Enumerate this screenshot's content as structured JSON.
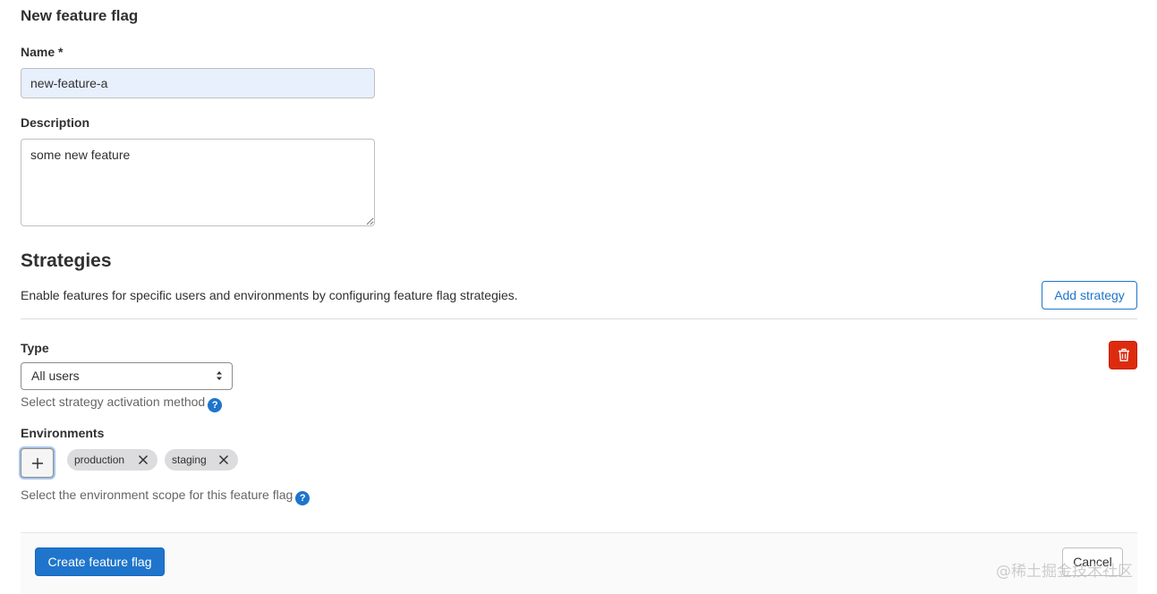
{
  "page": {
    "title": "New feature flag"
  },
  "form": {
    "name_label": "Name *",
    "name_value": "new-feature-a",
    "description_label": "Description",
    "description_value": "some new feature"
  },
  "strategies": {
    "heading": "Strategies",
    "description": "Enable features for specific users and environments by configuring feature flag strategies.",
    "add_label": "Add strategy",
    "type_label": "Type",
    "type_value": "All users",
    "type_help": "Select strategy activation method",
    "environments_label": "Environments",
    "environments": [
      {
        "name": "production"
      },
      {
        "name": "staging"
      }
    ],
    "environments_help": "Select the environment scope for this feature flag"
  },
  "footer": {
    "create_label": "Create feature flag",
    "cancel_label": "Cancel"
  },
  "watermark": "@稀土掘金技术社区",
  "icons": {
    "help": "question-circle-icon",
    "delete": "trash-icon",
    "add_env": "plus-icon",
    "remove_chip": "close-icon",
    "select": "select-arrows-icon"
  },
  "colors": {
    "primary": "#1f75cb",
    "danger": "#dd2b0e",
    "chip_bg": "#dcdcde",
    "autofill_bg": "#e8f0fe"
  }
}
